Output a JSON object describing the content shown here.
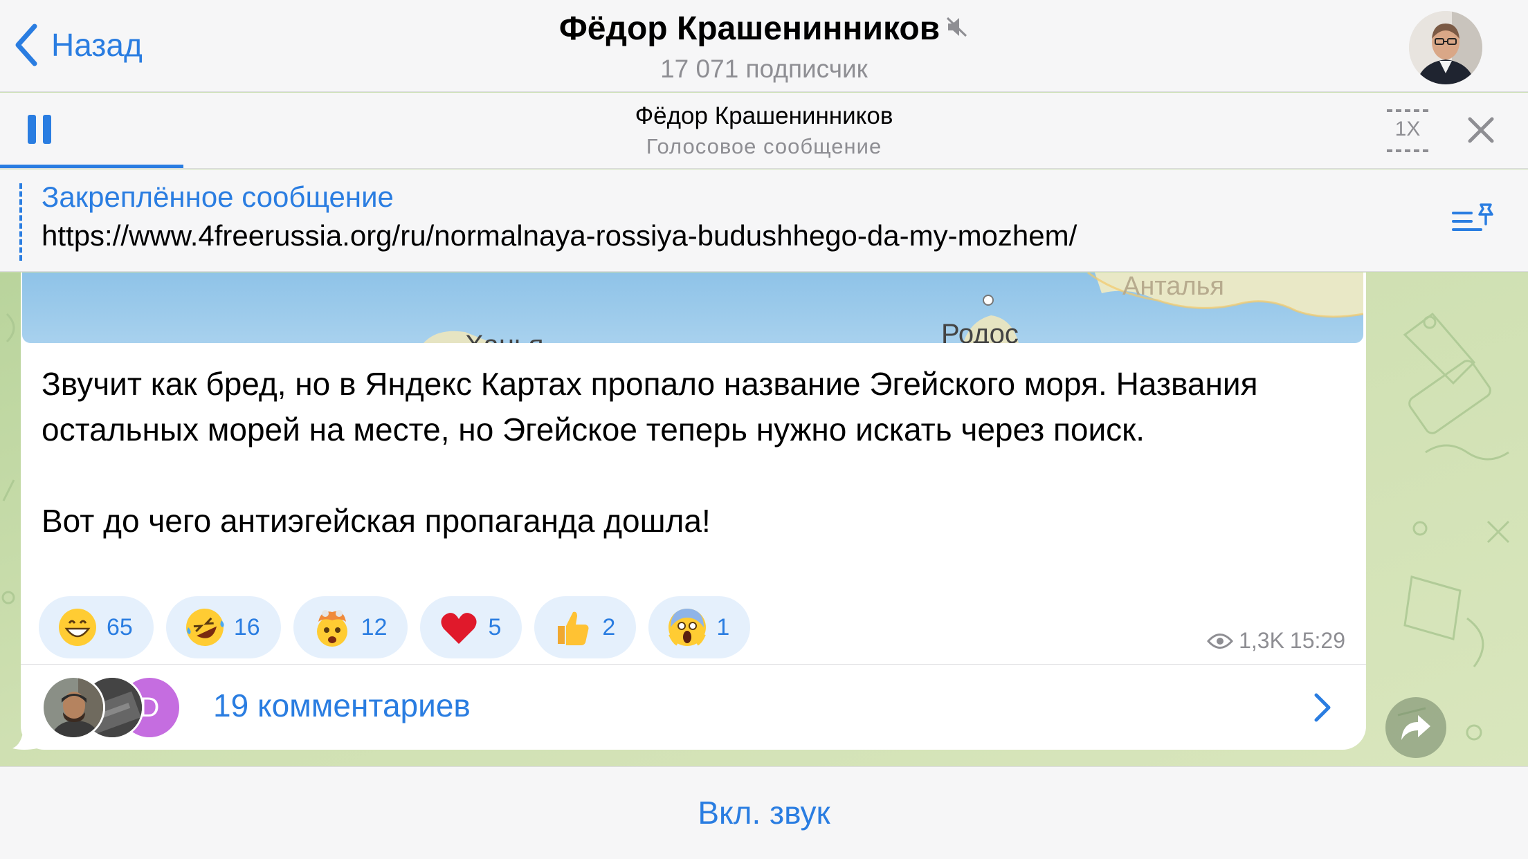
{
  "header": {
    "back_label": "Назад",
    "channel_name": "Фёдор Крашенинников",
    "subscribers": "17 071 подписчик"
  },
  "player": {
    "title": "Фёдор Крашенинников",
    "subtitle": "Голосовое сообщение",
    "speed": "1X",
    "progress": 0.12
  },
  "pinned": {
    "title": "Закреплённое сообщение",
    "text": "https://www.4freerussia.org/ru/normalnaya-rossiya-budushhego-da-my-mozhem/"
  },
  "map": {
    "labels": [
      "Анталья",
      "Родос",
      "Ханья"
    ]
  },
  "message": {
    "paragraph1": "Звучит как бред, но в Яндекс Картах пропало название Эгейского моря. Названия остальных морей на месте, но Эгейское теперь нужно искать через поиск.",
    "paragraph2": "Вот до чего антиэгейская пропаганда дошла!",
    "views": "1,3K",
    "time": "15:29"
  },
  "reactions": [
    {
      "icon": "grinning-face-icon",
      "count": "65"
    },
    {
      "icon": "rolling-laughing-face-icon",
      "count": "16"
    },
    {
      "icon": "exploding-head-icon",
      "count": "12"
    },
    {
      "icon": "red-heart-icon",
      "count": "5"
    },
    {
      "icon": "thumbs-up-icon",
      "count": "2"
    },
    {
      "icon": "screaming-face-icon",
      "count": "1"
    }
  ],
  "comments": {
    "label": "19 комментариев",
    "avatar_letter": "D"
  },
  "bottom": {
    "unmute_label": "Вкл. звук"
  },
  "colors": {
    "accent": "#2a7de1",
    "secondary_text": "#8e8e93",
    "reaction_bg": "#e5f0fc"
  }
}
